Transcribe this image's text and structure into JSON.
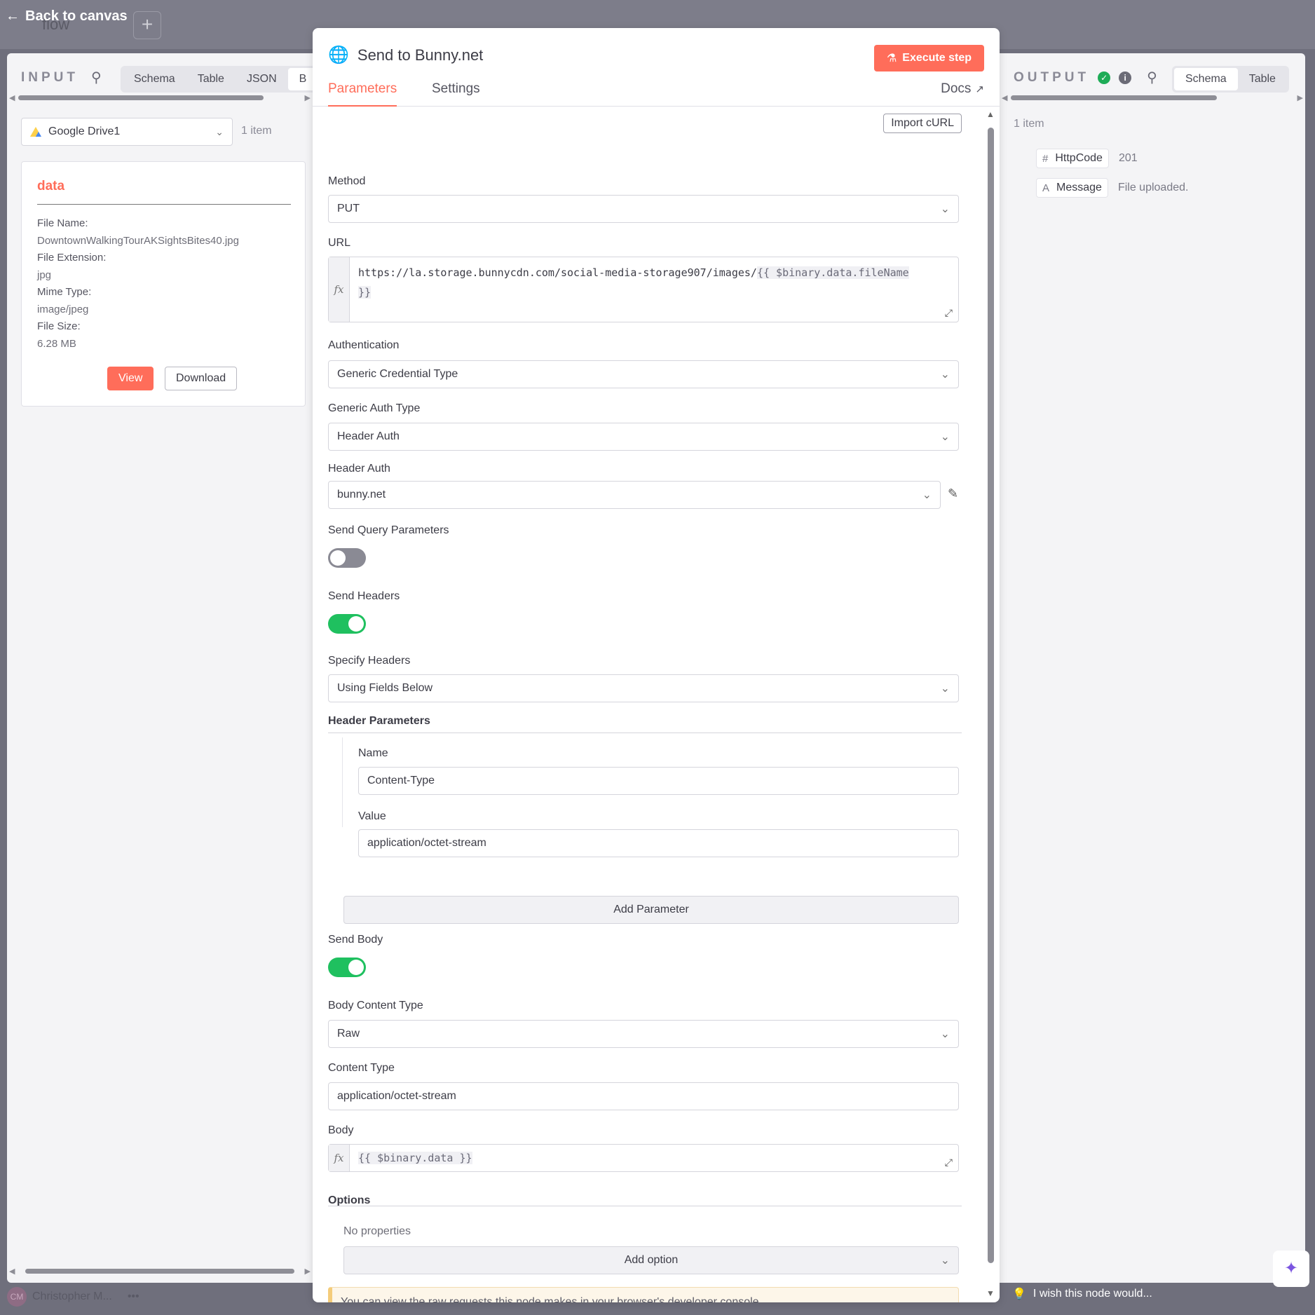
{
  "canvas": {
    "back_label": "Back to canvas",
    "add_label": "+",
    "behind_title": "flow"
  },
  "input": {
    "title": "INPUT",
    "tabs": [
      "Schema",
      "Table",
      "JSON",
      "B"
    ],
    "active_tab": "B",
    "node_select": "Google Drive1",
    "item_count": "1 item",
    "card": {
      "title": "data",
      "fields": [
        {
          "label": "File Name:",
          "value": "DowntownWalkingTourAKSightsBites40.jpg"
        },
        {
          "label": "File Extension:",
          "value": "jpg"
        },
        {
          "label": "Mime Type:",
          "value": "image/jpeg"
        },
        {
          "label": "File Size:",
          "value": "6.28 MB"
        }
      ],
      "view_label": "View",
      "download_label": "Download"
    }
  },
  "dialog": {
    "title": "Send to Bunny.net",
    "execute_label": "Execute step",
    "tabs": {
      "parameters": "Parameters",
      "settings": "Settings"
    },
    "docs_label": "Docs",
    "import_curl": "Import cURL",
    "method": {
      "label": "Method",
      "value": "PUT"
    },
    "url": {
      "label": "URL",
      "prefix": "https://la.storage.bunnycdn.com/social-media-storage907/images/",
      "template": "{{ $binary.data.fileName",
      "template_end": "}}"
    },
    "authentication": {
      "label": "Authentication",
      "value": "Generic Credential Type"
    },
    "generic_auth_type": {
      "label": "Generic Auth Type",
      "value": "Header Auth"
    },
    "header_auth": {
      "label": "Header Auth",
      "value": "bunny.net"
    },
    "send_query": {
      "label": "Send Query Parameters",
      "on": false
    },
    "send_headers": {
      "label": "Send Headers",
      "on": true
    },
    "specify_headers": {
      "label": "Specify Headers",
      "value": "Using Fields Below"
    },
    "header_parameters": {
      "label": "Header Parameters",
      "name_label": "Name",
      "name_value": "Content-Type",
      "value_label": "Value",
      "value_value": "application/octet-stream",
      "add_label": "Add Parameter"
    },
    "send_body": {
      "label": "Send Body",
      "on": true
    },
    "body_content_type": {
      "label": "Body Content Type",
      "value": "Raw"
    },
    "content_type": {
      "label": "Content Type",
      "value": "application/octet-stream"
    },
    "body": {
      "label": "Body",
      "value": "{{ $binary.data }}"
    },
    "options": {
      "label": "Options",
      "empty": "No properties",
      "add_label": "Add option"
    },
    "note": "You can view the raw requests this node makes in your browser's developer console"
  },
  "output": {
    "title": "OUTPUT",
    "tabs": [
      "Schema",
      "Table"
    ],
    "active_tab": "Schema",
    "item_count": "1 item",
    "rows": [
      {
        "type_icon": "#",
        "key": "HttpCode",
        "value": "201"
      },
      {
        "type_icon": "A",
        "key": "Message",
        "value": "File uploaded."
      }
    ]
  },
  "footer": {
    "wish": "I wish this node would...",
    "user_initials": "CM",
    "user_name": "Christopher M...",
    "more": "•••"
  },
  "colors": {
    "accent": "#ff6d5a",
    "toggle_on": "#1fc05f",
    "success": "#1eac57"
  }
}
